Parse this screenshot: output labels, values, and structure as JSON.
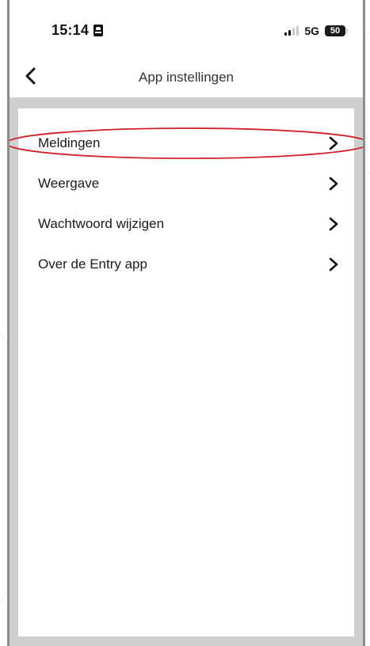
{
  "status_bar": {
    "time": "15:14",
    "network": "5G",
    "battery": "50"
  },
  "nav": {
    "title": "App instellingen"
  },
  "settings": {
    "items": [
      {
        "label": "Meldingen"
      },
      {
        "label": "Weergave"
      },
      {
        "label": "Wachtwoord wijzigen"
      },
      {
        "label": "Over de Entry app"
      }
    ]
  },
  "colors": {
    "highlight_circle": "#d0202a",
    "content_background": "#cfcfcf"
  }
}
